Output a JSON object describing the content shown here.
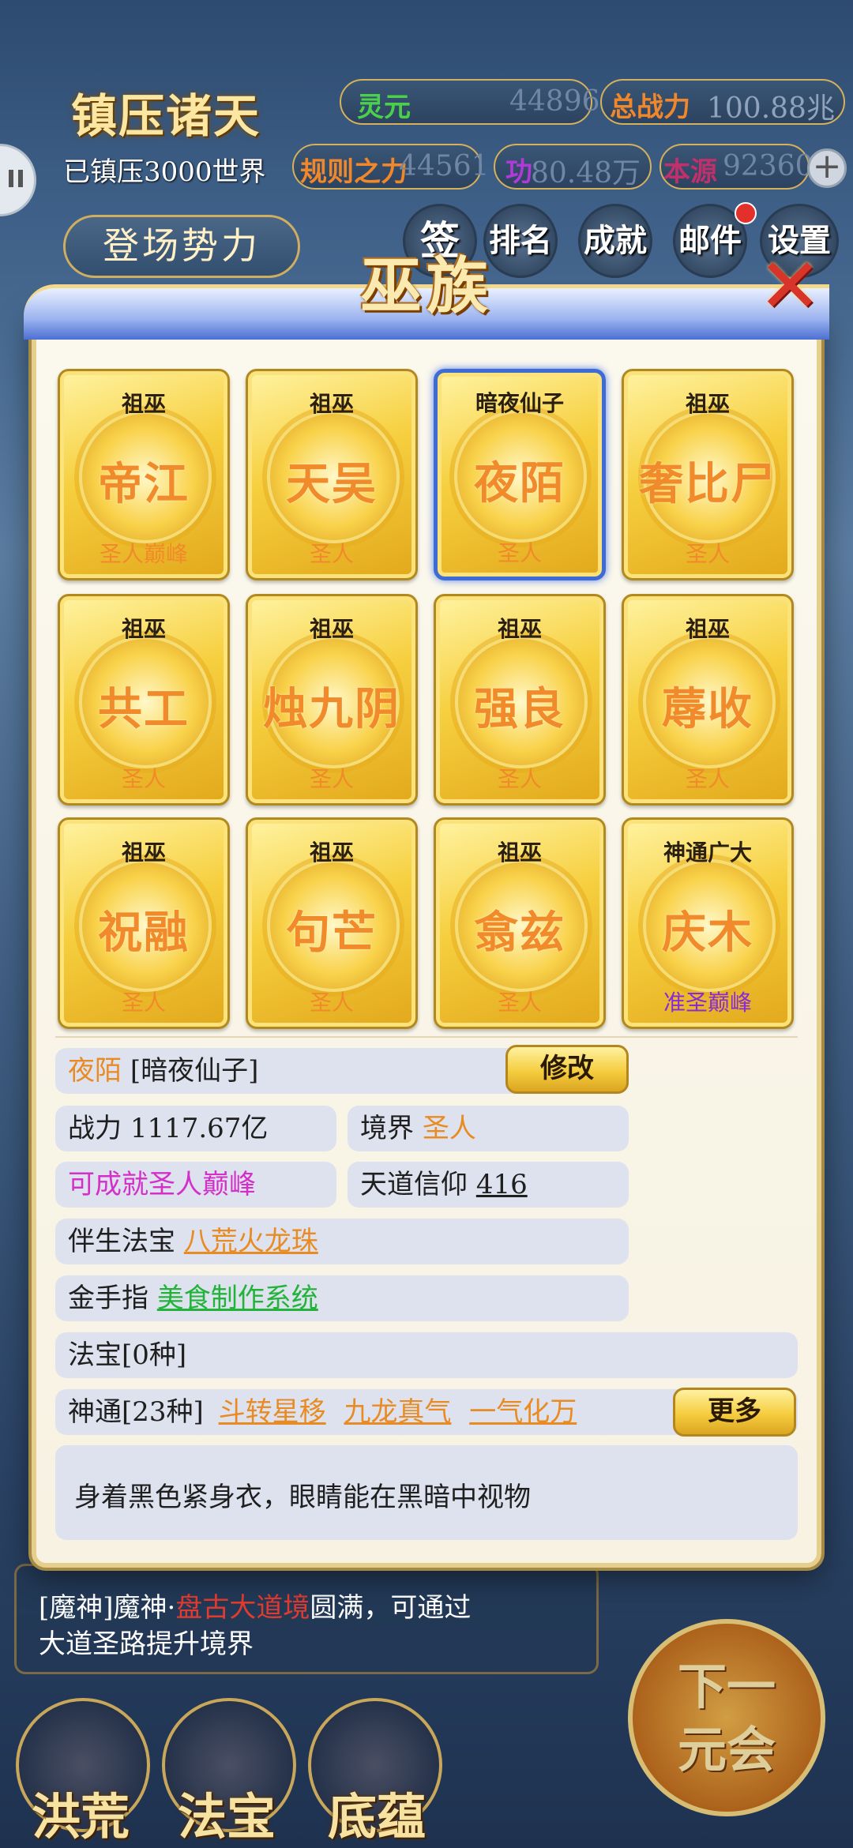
{
  "hud": {
    "title": "镇压诸天",
    "lingyuan_label": "灵元",
    "lingyuan_value": "44896",
    "power_label": "总战力",
    "power_value": "100.88兆",
    "suppressed": "已镇压3000世界",
    "rule_label": "规则之力",
    "rule_value": "44561",
    "merit_label": "功",
    "merit_value": "80.48万",
    "source_label": "本源",
    "source_value": "92360",
    "plus": "+",
    "login": "登场势力",
    "menu": [
      "签",
      "排名",
      "成就",
      "邮件",
      "设置"
    ]
  },
  "dialog": {
    "title": "巫族",
    "close": "✕",
    "cards": [
      {
        "title": "祖巫",
        "name": "帝江",
        "rank": "圣人巅峰"
      },
      {
        "title": "祖巫",
        "name": "天吴",
        "rank": "圣人"
      },
      {
        "title": "暗夜仙子",
        "name": "夜陌",
        "rank": "圣人"
      },
      {
        "title": "祖巫",
        "name": "奢比尸",
        "rank": "圣人"
      },
      {
        "title": "祖巫",
        "name": "共工",
        "rank": "圣人"
      },
      {
        "title": "祖巫",
        "name": "烛九阴",
        "rank": "圣人"
      },
      {
        "title": "祖巫",
        "name": "强良",
        "rank": "圣人"
      },
      {
        "title": "祖巫",
        "name": "蓐收",
        "rank": "圣人"
      },
      {
        "title": "祖巫",
        "name": "祝融",
        "rank": "圣人"
      },
      {
        "title": "祖巫",
        "name": "句芒",
        "rank": "圣人"
      },
      {
        "title": "祖巫",
        "name": "翕兹",
        "rank": "圣人"
      },
      {
        "title": "神通广大",
        "name": "庆木",
        "rank": "准圣巅峰"
      }
    ],
    "detail": {
      "name": "夜陌",
      "title_bracket": "[暗夜仙子]",
      "modify": "修改",
      "power_label": "战力",
      "power_value": "1117.67亿",
      "realm_label": "境界",
      "realm_value": "圣人",
      "achievable": "可成就圣人巅峰",
      "faith_label": "天道信仰",
      "faith_value": "416",
      "treasure_label": "伴生法宝",
      "treasure_value": "八荒火龙珠",
      "finger_label": "金手指",
      "finger_value": "美食制作系统",
      "fabao": "法宝[0种]",
      "shentong_label": "神通[23种]",
      "shentong_items": [
        "斗转星移",
        "九龙真气",
        "一气化万"
      ],
      "more": "更多",
      "description": "身着黑色紧身衣，眼睛能在黑暗中视物"
    }
  },
  "message": {
    "prefix": "[魔神]魔神·",
    "highlight": "盘古大道境",
    "suffix": "圆满，可通过",
    "line2": "大道圣路提升境界"
  },
  "bottom_nav": [
    "洪荒",
    "法宝",
    "底蕴"
  ],
  "next_button": [
    "下一",
    "元会"
  ],
  "colors": {
    "accent_gold": "#f6cf3e",
    "name_orange": "#e88b23",
    "select_blue": "#3f6cd4",
    "magenta": "#d430c9",
    "green": "#23b33a"
  }
}
